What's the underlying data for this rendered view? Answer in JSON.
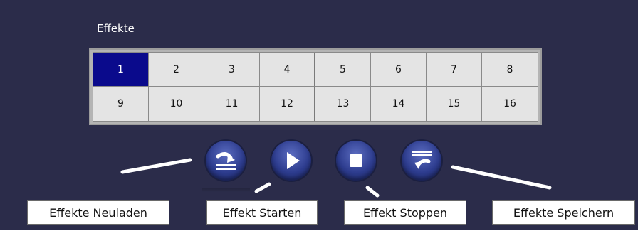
{
  "effects": {
    "group_label": "Effekte",
    "selected": "1",
    "slots": [
      "1",
      "2",
      "3",
      "4",
      "5",
      "6",
      "7",
      "8",
      "9",
      "10",
      "11",
      "12",
      "13",
      "14",
      "15",
      "16"
    ]
  },
  "controls": [
    {
      "id": "reload",
      "icon": "reload-icon"
    },
    {
      "id": "start",
      "icon": "play-icon"
    },
    {
      "id": "stop",
      "icon": "stop-icon"
    },
    {
      "id": "save",
      "icon": "save-icon"
    }
  ],
  "callouts": {
    "reload": "Effekte Neuladen",
    "start": "Effekt Starten",
    "stop": "Effekt Stoppen",
    "save": "Effekte Speichern"
  },
  "colors": {
    "panel_background": "#2b2c4a",
    "selected_slot": "#0a0a8c",
    "slot": "#e4e4e4",
    "button": "#2d3c8e"
  }
}
